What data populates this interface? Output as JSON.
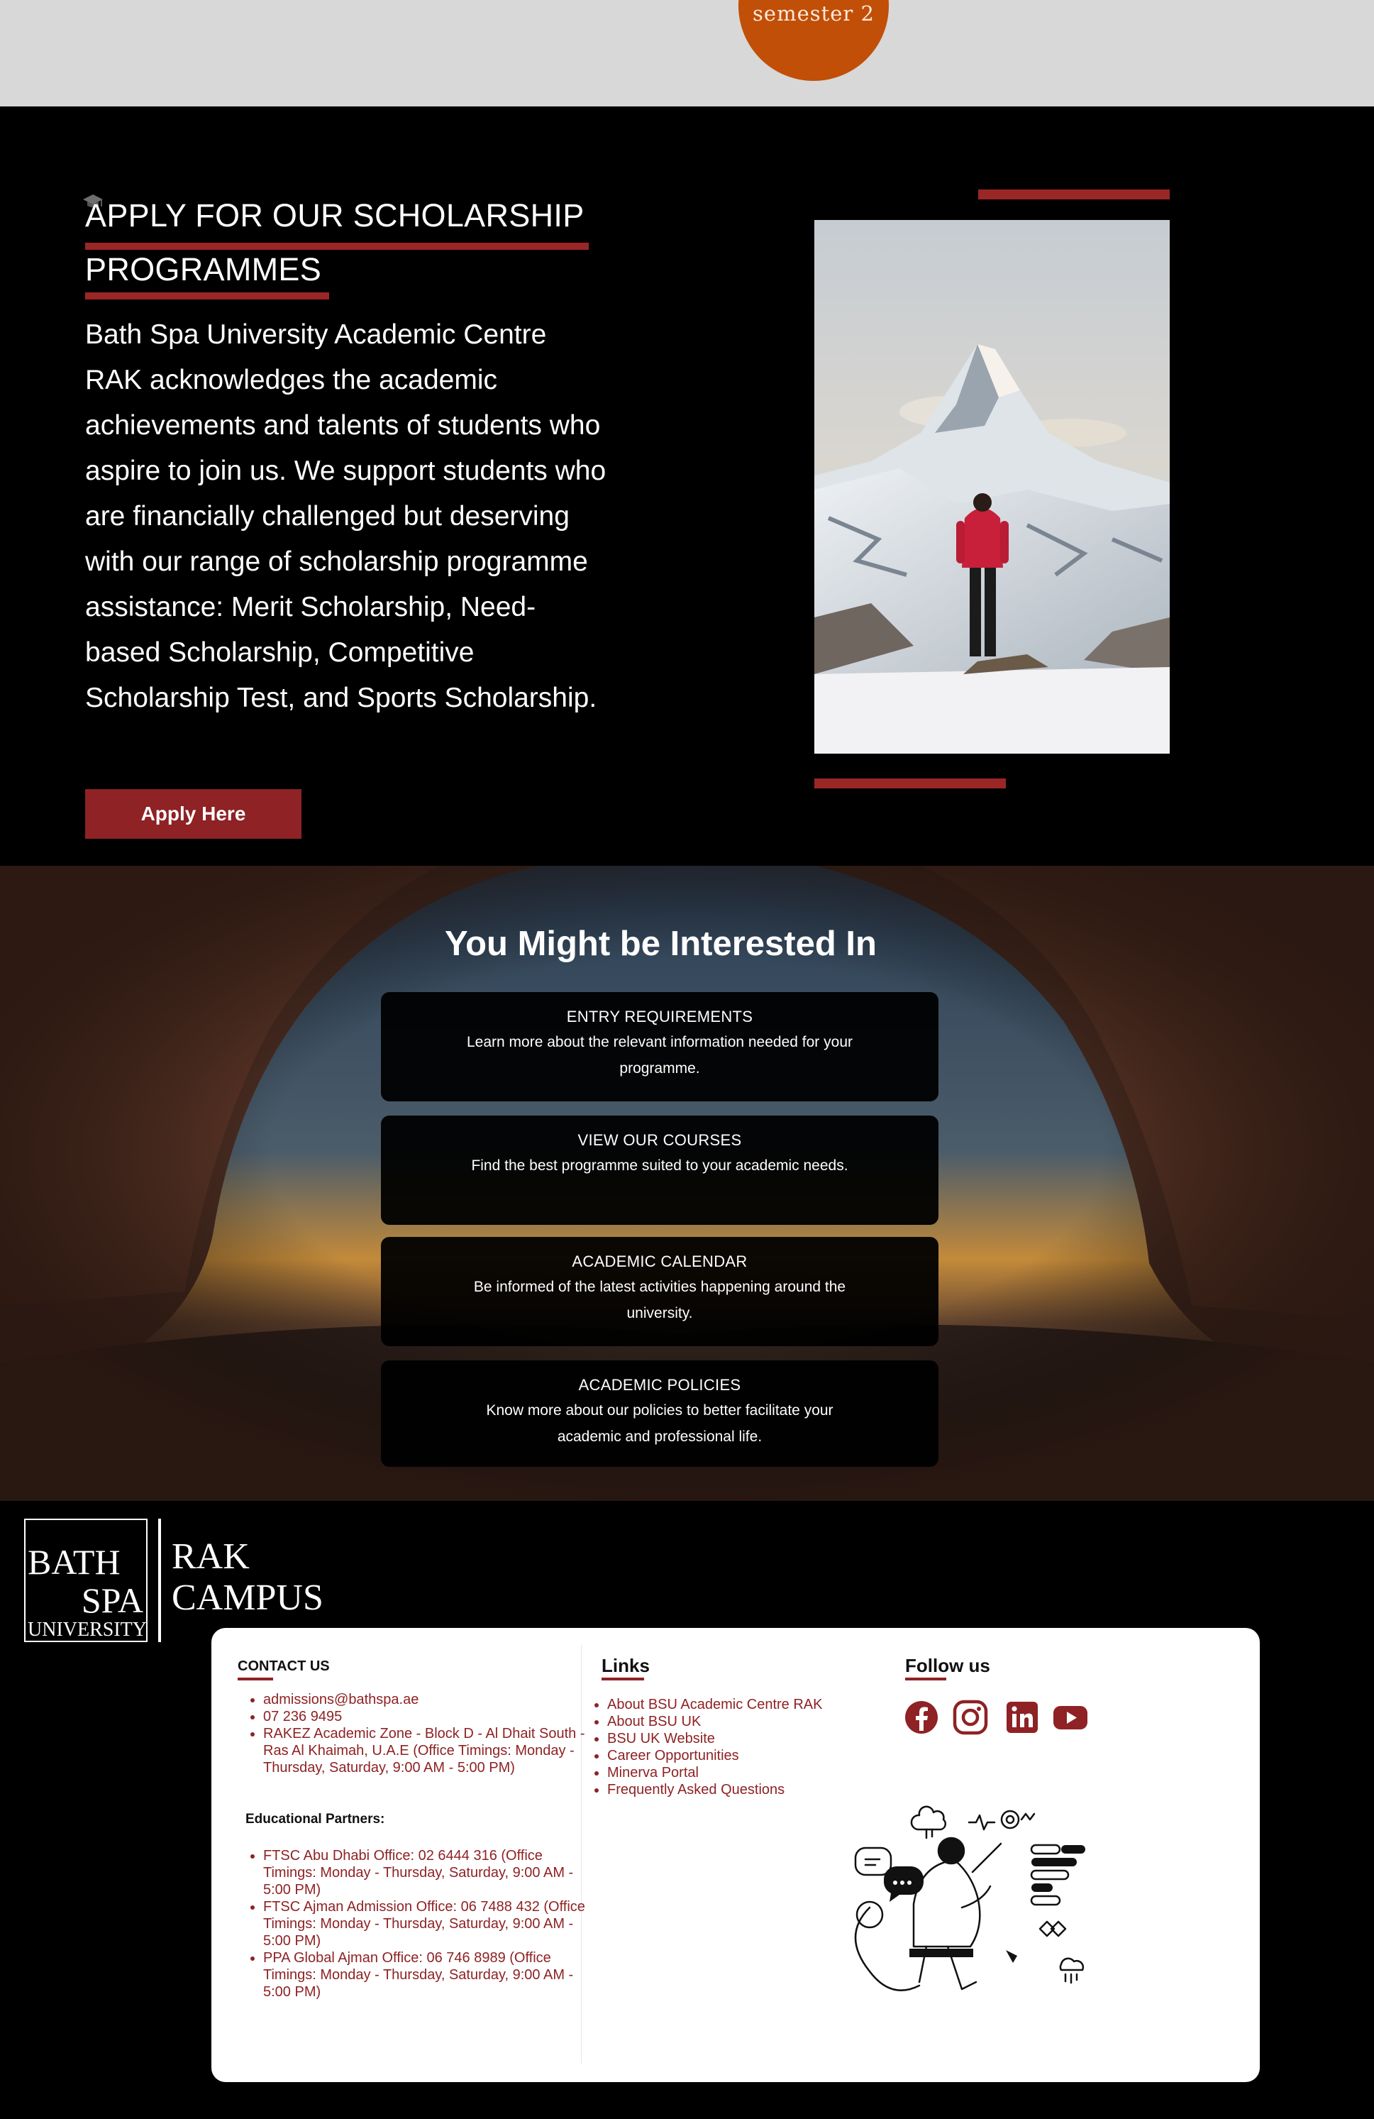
{
  "top_band": {
    "semester_label": "semester 2"
  },
  "scholarship": {
    "title_line1": "APPLY FOR OUR SCHOLARSHIP",
    "title_line2": "PROGRAMMES",
    "body": "Bath Spa University Academic Centre RAK acknowledges the academic achievements and talents of students who aspire to join us. We support students who are financially challenged but deserving with our range of scholarship programme assistance: Merit Scholarship, Need-based Scholarship, Competitive Scholarship Test, and Sports Scholarship.",
    "button_label": "Apply Here"
  },
  "interested": {
    "title": "You Might be Interested In",
    "cards": [
      {
        "title": "ENTRY REQUIREMENTS",
        "desc": "Learn more about the relevant information needed for your programme."
      },
      {
        "title": "VIEW OUR COURSES",
        "desc": "Find the best programme suited to your academic needs."
      },
      {
        "title": "ACADEMIC CALENDAR",
        "desc": "Be informed of the latest activities happening around the university."
      },
      {
        "title": "ACADEMIC POLICIES",
        "desc": "Know more about our policies to better facilitate your academic and professional life."
      }
    ]
  },
  "footer": {
    "logo": {
      "line1": "BATH",
      "line2": "SPA",
      "line3": "UNIVERSITY",
      "campus1": "RAK",
      "campus2": "CAMPUS"
    },
    "contact": {
      "heading": "CONTACT US",
      "items": [
        "admissions@bathspa.ae",
        "07 236 9495",
        "RAKEZ Academic Zone - Block D - Al Dhait South - Ras Al Khaimah, U.A.E (Office Timings: Monday - Thursday, Saturday, 9:00 AM - 5:00 PM)"
      ],
      "partners_heading": "Educational Partners:",
      "partners": [
        "FTSC Abu Dhabi Office: 02 6444 316 (Office Timings: Monday - Thursday, Saturday, 9:00 AM - 5:00 PM)",
        "FTSC Ajman Admission Office: 06 7488 432 (Office Timings: Monday - Thursday, Saturday, 9:00 AM - 5:00 PM)",
        "PPA Global Ajman Office: 06 746 8989 (Office Timings: Monday - Thursday, Saturday, 9:00 AM - 5:00 PM)"
      ]
    },
    "links": {
      "heading": "Links",
      "items": [
        "About BSU Academic Centre RAK",
        "About BSU UK",
        "BSU UK Website",
        "Career Opportunities",
        "Minerva Portal",
        "Frequently Asked Questions"
      ]
    },
    "follow": {
      "heading": "Follow us",
      "icons": [
        "facebook-icon",
        "instagram-icon",
        "linkedin-icon",
        "youtube-icon"
      ]
    }
  },
  "colors": {
    "accent_red": "#8e2224",
    "semester_orange": "#c14f08",
    "top_band_gray": "#d8d8d8"
  }
}
